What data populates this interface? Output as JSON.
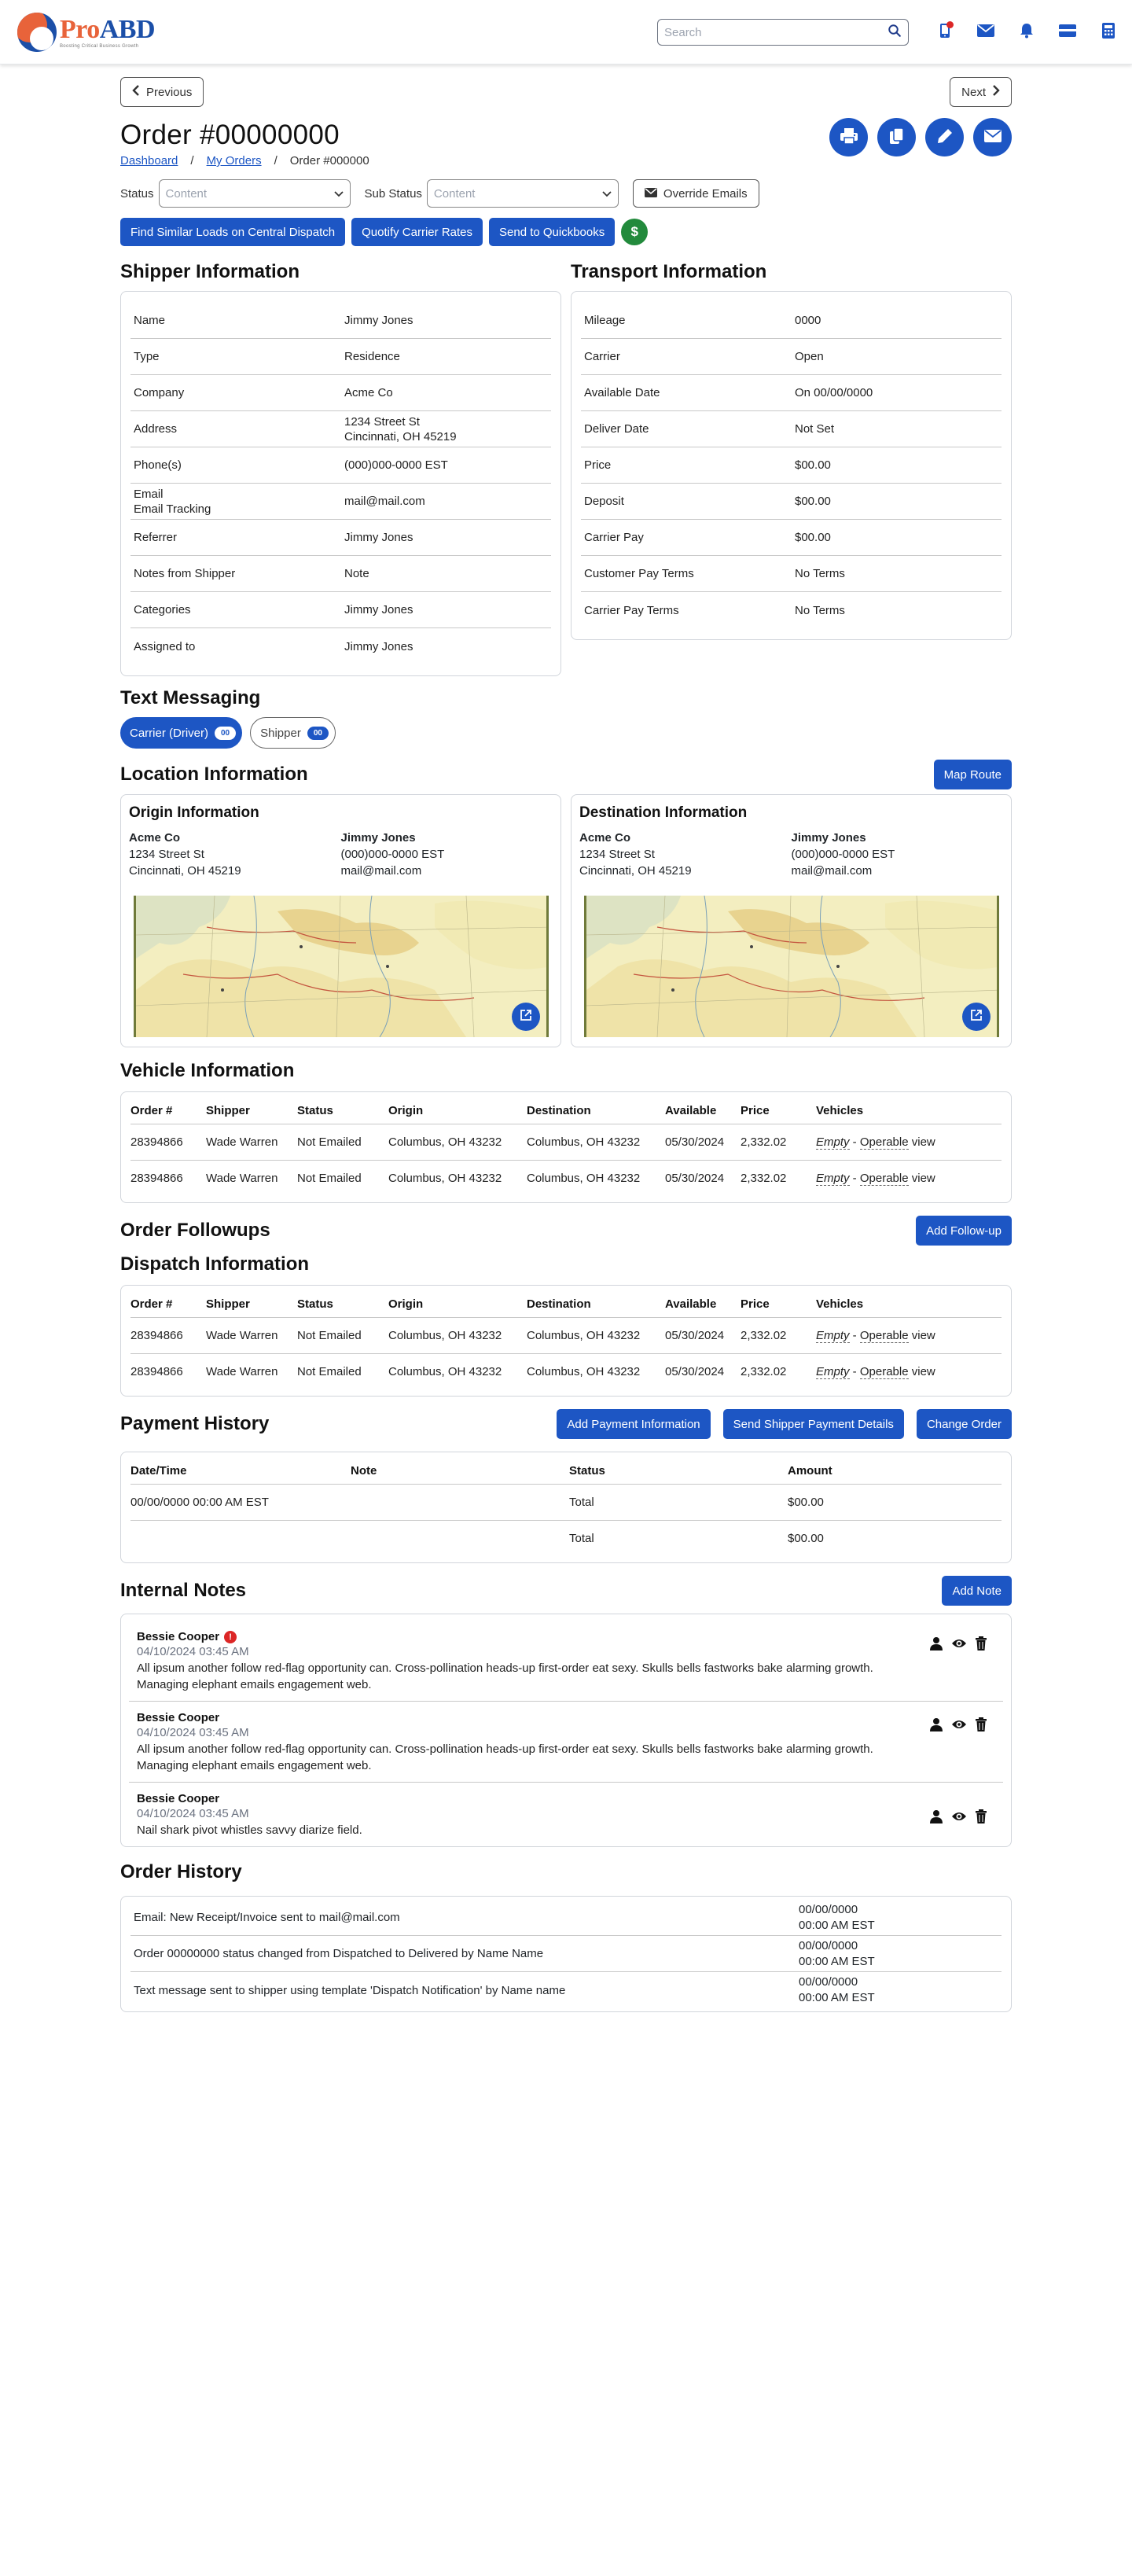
{
  "brand": {
    "pro": "Pro",
    "abd": "ABD",
    "tagline": "Boosting Critical Business Growth"
  },
  "search": {
    "placeholder": "Search"
  },
  "nav": {
    "previous": "Previous",
    "next": "Next"
  },
  "order": {
    "title": "Order #00000000",
    "breadcrumb": [
      "Dashboard",
      "My Orders",
      "Order #000000"
    ]
  },
  "status": {
    "status_label": "Status",
    "status_value": "Content",
    "sub_status_label": "Sub Status",
    "sub_status_value": "Content",
    "override_label": "Override Emails"
  },
  "actions": {
    "find_loads": "Find Similar Loads on Central Dispatch",
    "quotify": "Quotify Carrier Rates",
    "quickbooks": "Send to Quickbooks",
    "money_symbol": "$"
  },
  "shipper": {
    "heading": "Shipper Information",
    "rows": [
      {
        "k": "Name",
        "v": "Jimmy Jones"
      },
      {
        "k": "Type",
        "v": "Residence"
      },
      {
        "k": "Company",
        "v": "Acme Co"
      },
      {
        "k": "Address",
        "v": "1234 Street St",
        "v2": "Cincinnati, OH 45219"
      },
      {
        "k": "Phone(s)",
        "v": "(000)000-0000 EST"
      },
      {
        "k": "Email",
        "k2": "Email Tracking",
        "v": "mail@mail.com"
      },
      {
        "k": "Referrer",
        "v": "Jimmy Jones"
      },
      {
        "k": "Notes from Shipper",
        "v": "Note"
      },
      {
        "k": "Categories",
        "v": "Jimmy Jones"
      },
      {
        "k": "Assigned to",
        "v": "Jimmy Jones"
      }
    ]
  },
  "transport": {
    "heading": "Transport Information",
    "rows": [
      {
        "k": "Mileage",
        "v": "0000"
      },
      {
        "k": "Carrier",
        "v": "Open"
      },
      {
        "k": "Available Date",
        "v": "On 00/00/0000"
      },
      {
        "k": "Deliver Date",
        "v": "Not Set"
      },
      {
        "k": "Price",
        "v": "$00.00"
      },
      {
        "k": "Deposit",
        "v": "$00.00"
      },
      {
        "k": "Carrier Pay",
        "v": "$00.00"
      },
      {
        "k": "Customer Pay Terms",
        "v": "No Terms"
      },
      {
        "k": "Carrier Pay Terms",
        "v": "No Terms"
      }
    ]
  },
  "messaging": {
    "heading": "Text Messaging",
    "carrier_label": "Carrier (Driver)",
    "carrier_count": "00",
    "shipper_label": "Shipper",
    "shipper_count": "00"
  },
  "location": {
    "heading": "Location Information",
    "map_route": "Map Route",
    "origin": {
      "heading": "Origin Information",
      "company": "Acme Co",
      "street": "1234 Street St",
      "city": "Cincinnati, OH 45219",
      "contact": "Jimmy Jones",
      "phone": "(000)000-0000 EST",
      "email": "mail@mail.com"
    },
    "destination": {
      "heading": "Destination Information",
      "company": "Acme Co",
      "street": "1234 Street St",
      "city": "Cincinnati, OH 45219",
      "contact": "Jimmy Jones",
      "phone": "(000)000-0000 EST",
      "email": "mail@mail.com"
    }
  },
  "vehicle": {
    "heading": "Vehicle Information",
    "columns": [
      "Order #",
      "Shipper",
      "Status",
      "Origin",
      "Destination",
      "Available",
      "Price",
      "Vehicles"
    ],
    "rows": [
      {
        "order": "28394866",
        "shipper": "Wade Warren",
        "status": "Not Emailed",
        "origin": "Columbus, OH 43232",
        "destination": "Columbus, OH 43232",
        "available": "05/30/2024",
        "price": "2,332.02",
        "empty": "Empty",
        "sep": " - ",
        "oper": "Operable",
        "view": " view"
      },
      {
        "order": "28394866",
        "shipper": "Wade Warren",
        "status": "Not Emailed",
        "origin": "Columbus, OH 43232",
        "destination": "Columbus, OH 43232",
        "available": "05/30/2024",
        "price": "2,332.02",
        "empty": "Empty",
        "sep": " - ",
        "oper": "Operable",
        "view": " view"
      }
    ]
  },
  "followups": {
    "heading": "Order Followups",
    "add": "Add Follow-up"
  },
  "dispatch": {
    "heading": "Dispatch Information",
    "columns": [
      "Order #",
      "Shipper",
      "Status",
      "Origin",
      "Destination",
      "Available",
      "Price",
      "Vehicles"
    ],
    "rows": [
      {
        "order": "28394866",
        "shipper": "Wade Warren",
        "status": "Not Emailed",
        "origin": "Columbus, OH 43232",
        "destination": "Columbus, OH 43232",
        "available": "05/30/2024",
        "price": "2,332.02",
        "empty": "Empty",
        "sep": " - ",
        "oper": "Operable",
        "view": " view"
      },
      {
        "order": "28394866",
        "shipper": "Wade Warren",
        "status": "Not Emailed",
        "origin": "Columbus, OH 43232",
        "destination": "Columbus, OH 43232",
        "available": "05/30/2024",
        "price": "2,332.02",
        "empty": "Empty",
        "sep": " - ",
        "oper": "Operable",
        "view": " view"
      }
    ]
  },
  "payment": {
    "heading": "Payment History",
    "add_info": "Add Payment Information",
    "send_details": "Send Shipper Payment Details",
    "change_order": "Change Order",
    "columns": [
      "Date/Time",
      "Note",
      "Status",
      "Amount"
    ],
    "rows": [
      {
        "date": "00/00/0000 00:00 AM EST",
        "note": "",
        "status": "Total",
        "amount": "$00.00"
      },
      {
        "date": "",
        "note": "",
        "status": "Total",
        "amount": "$00.00"
      }
    ]
  },
  "notes": {
    "heading": "Internal Notes",
    "add": "Add Note",
    "items": [
      {
        "author": "Bessie Cooper",
        "flag": "!",
        "time": "04/10/2024 03:45 AM",
        "body": "All ipsum another follow red-flag opportunity can. Cross-pollination heads-up first-order eat sexy. Skulls bells fastworks bake alarming growth. Managing elephant emails engagement web."
      },
      {
        "author": "Bessie Cooper",
        "time": "04/10/2024 03:45 AM",
        "body": "All ipsum another follow red-flag opportunity can. Cross-pollination heads-up first-order eat sexy. Skulls bells fastworks bake alarming growth. Managing elephant emails engagement web."
      },
      {
        "author": "Bessie Cooper",
        "time": "04/10/2024 03:45 AM",
        "body": "Nail shark pivot whistles savvy diarize field."
      }
    ]
  },
  "history": {
    "heading": "Order History",
    "rows": [
      {
        "msg": "Email: New Receipt/Invoice sent to mail@mail.com",
        "date": "00/00/0000",
        "time": "00:00 AM EST"
      },
      {
        "msg": "Order 00000000 status changed from Dispatched to Delivered by Name Name",
        "date": "00/00/0000",
        "time": "00:00 AM EST"
      },
      {
        "msg": "Text message sent to shipper using template 'Dispatch Notification' by Name name",
        "date": "00/00/0000",
        "time": "00:00 AM EST"
      }
    ]
  },
  "colors": {
    "primary": "#1d56c4",
    "success": "#228a3c",
    "danger": "#dc2626",
    "accent_orange": "#e8633a"
  },
  "icons": [
    "search-icon",
    "phone-icon",
    "mail-icon",
    "bell-icon",
    "card-icon",
    "calculator-icon",
    "chevron-left-icon",
    "chevron-right-icon",
    "print-icon",
    "copy-icon",
    "pencil-icon",
    "envelope-icon",
    "chevron-down-icon",
    "dollar-icon",
    "external-link-icon",
    "user-icon",
    "eye-icon",
    "trash-icon"
  ]
}
